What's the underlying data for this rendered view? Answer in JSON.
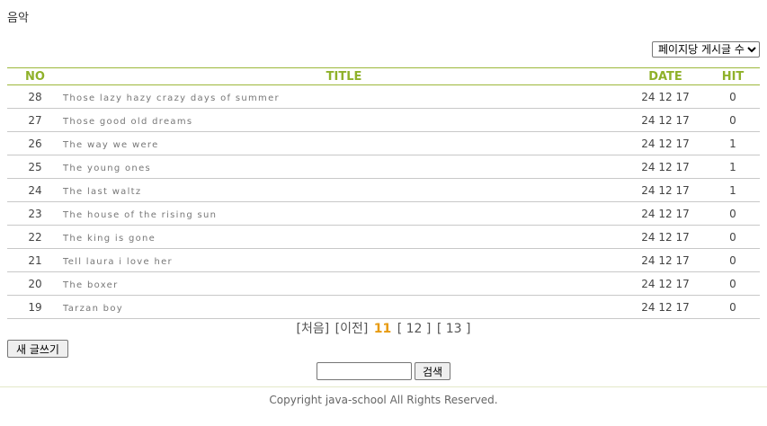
{
  "board": {
    "title": "음악"
  },
  "per_page_select": {
    "selected": "페이지당 게시글 수"
  },
  "table": {
    "headers": {
      "no": "NO",
      "title": "TITLE",
      "date": "DATE",
      "hit": "HIT"
    },
    "rows": [
      {
        "no": "28",
        "title": "Those lazy hazy crazy days of summer",
        "date": "24 12 17",
        "hit": "0"
      },
      {
        "no": "27",
        "title": "Those good old dreams",
        "date": "24 12 17",
        "hit": "0"
      },
      {
        "no": "26",
        "title": "The way we were",
        "date": "24 12 17",
        "hit": "1"
      },
      {
        "no": "25",
        "title": "The young ones",
        "date": "24 12 17",
        "hit": "1"
      },
      {
        "no": "24",
        "title": "The last waltz",
        "date": "24 12 17",
        "hit": "1"
      },
      {
        "no": "23",
        "title": "The house of the rising sun",
        "date": "24 12 17",
        "hit": "0"
      },
      {
        "no": "22",
        "title": "The king is gone",
        "date": "24 12 17",
        "hit": "0"
      },
      {
        "no": "21",
        "title": "Tell laura i love her",
        "date": "24 12 17",
        "hit": "0"
      },
      {
        "no": "20",
        "title": "The boxer",
        "date": "24 12 17",
        "hit": "0"
      },
      {
        "no": "19",
        "title": "Tarzan boy",
        "date": "24 12 17",
        "hit": "0"
      }
    ]
  },
  "paging": {
    "first": "[처음]",
    "prev": "[이전]",
    "current": "11",
    "pages": [
      "[ 12 ]",
      "[ 13 ]"
    ]
  },
  "actions": {
    "write": "새 글쓰기",
    "search": "검색",
    "search_value": ""
  },
  "footer": {
    "text": "Copyright java-school All Rights Reserved."
  }
}
